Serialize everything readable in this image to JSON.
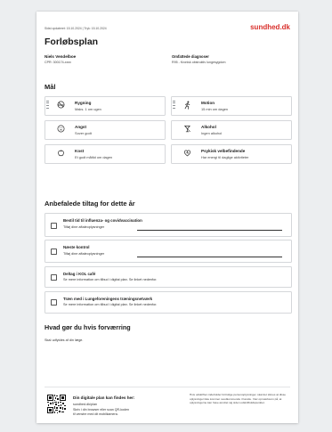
{
  "meta": {
    "updated": "Sidst opdateret: 15.10.2024 | Tryk: 15.10.2024"
  },
  "brand": {
    "logo": "sundhed.dk",
    "accent": "#d9302c"
  },
  "page": {
    "title": "Forløbsplan"
  },
  "patient": {
    "name": "Niels Vendelboe",
    "cpr": "CPR: 300174-xxxx"
  },
  "diagnosis": {
    "label": "Omfattede diagnoser",
    "value": "R95 - Kronisk obstruktiv lungesygdom"
  },
  "goals": {
    "heading": "Mål",
    "items": [
      {
        "icon": "no-smoking-icon",
        "title": "Rygning",
        "subtitle": "Maks. 1 om ugen"
      },
      {
        "icon": "running-icon",
        "title": "Motion",
        "subtitle": "15 min om dagen"
      },
      {
        "icon": "worry-icon",
        "title": "Angst",
        "subtitle": "Sover godt"
      },
      {
        "icon": "glass-icon",
        "title": "Alkohol",
        "subtitle": "Ingen alkohol"
      },
      {
        "icon": "apple-icon",
        "title": "Kost",
        "subtitle": "Et godt måltid om dagen"
      },
      {
        "icon": "wellbeing-icon",
        "title": "Psykisk velbefindende",
        "subtitle": "Har energi til daglige aktiviteter"
      }
    ]
  },
  "recommendations": {
    "heading": "Anbefalede tiltag for dette år",
    "items": [
      {
        "title": "Bestil tid til influenza- og covidvaccination",
        "subtitle": "Tilføj dine aftaleoplysninger"
      },
      {
        "title": "Næste kontrol",
        "subtitle": "Tilføj dine aftaleoplysninger"
      },
      {
        "title": "Deltag i KOL café",
        "subtitle": "Se mere information om tilbud i digital plan. Se linket nedenfor."
      },
      {
        "title": "Træn med i Lungeforeningens træningsnetværk",
        "subtitle": "Se mere information om tilbud i digital plan. Se linket nedenfor."
      }
    ]
  },
  "worse": {
    "heading": "Hvad gør du hvis forværring",
    "text": "Skal udfyldes af din læge."
  },
  "footer": {
    "title": "Din digitale plan kan findes her:",
    "url": "sundhed.dk/plan",
    "desc1": "Skriv i din browser eller scan QR-koden",
    "desc2": "til venstre med dit mobilkamera.",
    "disclaimer": "Hvis udskriften indeholder fortrolige personoplysninger, skal det slimes at disse oplysninger ikke kommer uvedkommende i hænde. Vær opmærksom på, at oplysningerne kan have ændret sig siden udskriftstidspunktet."
  }
}
